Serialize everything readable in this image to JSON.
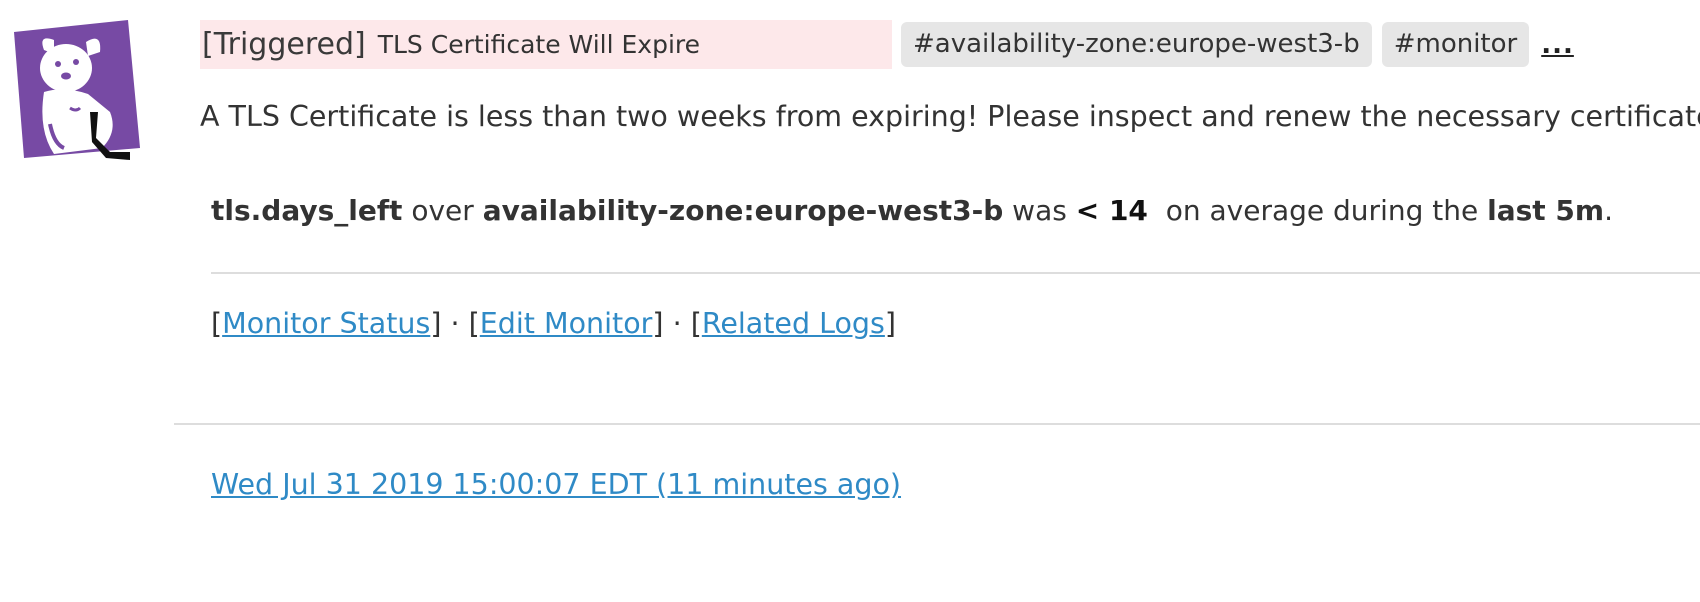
{
  "alert": {
    "status": "[Triggered]",
    "title": "TLS Certificate Will Expire",
    "tags": [
      "#availability-zone:europe-west3-b",
      "#monitor"
    ],
    "more_label": "...",
    "description": "A TLS Certificate is less than two weeks from expiring! Please inspect and renew the necessary certificate.",
    "metric": "tls.days_left",
    "over_word": "over",
    "scope": "availability-zone:europe-west3-b",
    "was_word": "was",
    "comparator": "< 14",
    "average_phrase": "on average during the",
    "window": "last 5m",
    "period": "."
  },
  "links": {
    "monitor_status": "Monitor Status",
    "edit_monitor": "Edit Monitor",
    "related_logs": "Related Logs",
    "open_bracket": "[",
    "close_bracket": "]",
    "separator": "·"
  },
  "timestamp": "Wed Jul 31 2019 15:00:07 EDT (11 minutes ago)",
  "icons": {
    "avatar": "datadog-logo-icon"
  },
  "colors": {
    "title_background": "#fde8ea",
    "tag_background": "#e6e6e6",
    "link": "#2f8ac6",
    "brand_purple": "#774aa4"
  }
}
